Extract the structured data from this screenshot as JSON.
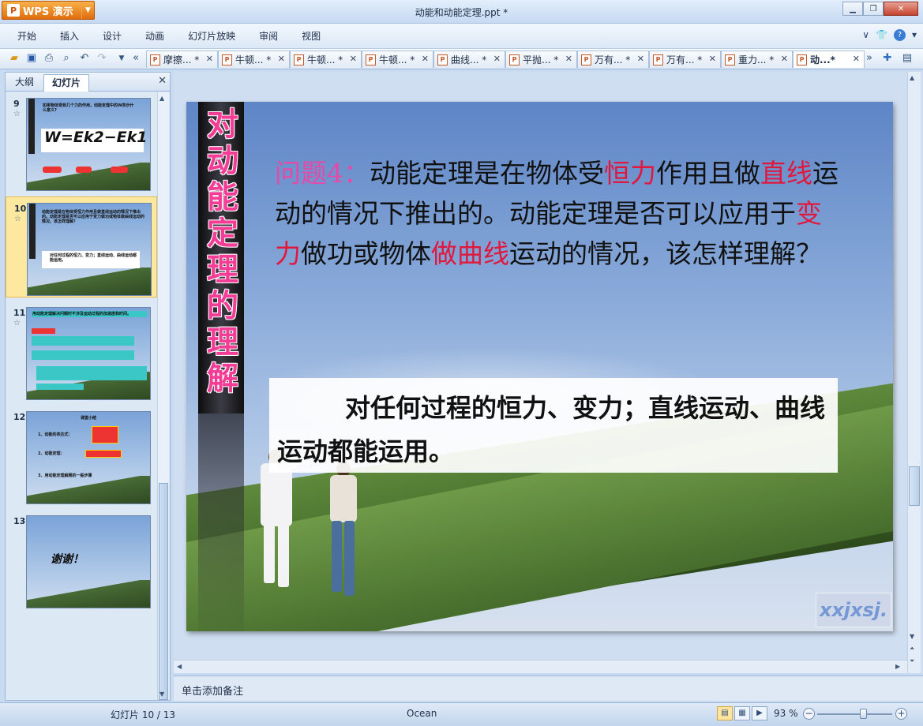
{
  "app": {
    "name": "WPS 演示",
    "logo_glyph": "P",
    "document_title": "动能和动能定理.ppt *"
  },
  "menu": [
    "开始",
    "插入",
    "设计",
    "动画",
    "幻灯片放映",
    "审阅",
    "视图"
  ],
  "doc_tabs": [
    "摩擦... *",
    "牛顿... *",
    "牛顿... *",
    "牛顿... *",
    "曲线... *",
    "平抛... *",
    "万有... *",
    "万有... *",
    "重力... *",
    "动...*"
  ],
  "left_pane": {
    "tabs": [
      "大纲",
      "幻灯片"
    ],
    "slides": [
      {
        "num": "9",
        "star": "☆",
        "title": "如果物体受到几个力的作用，动能定理中的W表示什么意义?",
        "formula": "W=Ek2−Ek1"
      },
      {
        "num": "10",
        "star": "☆",
        "title": "动能定理是在物体受恒力作用且做直线运动的情况下推出的。动能定理是否可以应用于变力做功或物体做曲线运动的情况，该怎样理解？",
        "body": "对任何过程的恒力、变力；直线运动、曲线运动都能运用。"
      },
      {
        "num": "11",
        "star": "☆",
        "title": "用动能定理解决问题时不涉及运动过程的加速度和时间。"
      },
      {
        "num": "12",
        "star": "",
        "title": "课堂小结",
        "items": [
          "1、动能的表达式：",
          "2、动能定理：",
          "3、用动能定理解题的一般步骤"
        ]
      },
      {
        "num": "13",
        "star": "",
        "title": "谢谢！"
      }
    ]
  },
  "slide": {
    "vertical_title": "对动能定理的理解",
    "question_label": "问题4",
    "question_colon": "：",
    "q1": "动能定理是在物体受",
    "q_red1": "恒力",
    "q2": "作用且做",
    "q_red2": "直线",
    "q3": "运动的情况下推出的。动能定理是否可以应用于",
    "q_red3": "变力",
    "q4": "做功或物体",
    "q_red4": "做曲线",
    "q5": "运动的情况，该怎样理解？",
    "answer": "对任何过程的恒力、变力；直线运动、曲线运动都能运用。",
    "watermark": "xxjxsj."
  },
  "notes_placeholder": "单击添加备注",
  "status": {
    "slide_counter": "幻灯片 10 / 13",
    "theme": "Ocean",
    "zoom": "93 %",
    "zoom_level": 0.62
  },
  "colors": {
    "title_pink": "#f23c96",
    "keyword_red": "#e0183e",
    "question_pink": "#e64aa8",
    "wps_orange": "#e06c0c"
  }
}
